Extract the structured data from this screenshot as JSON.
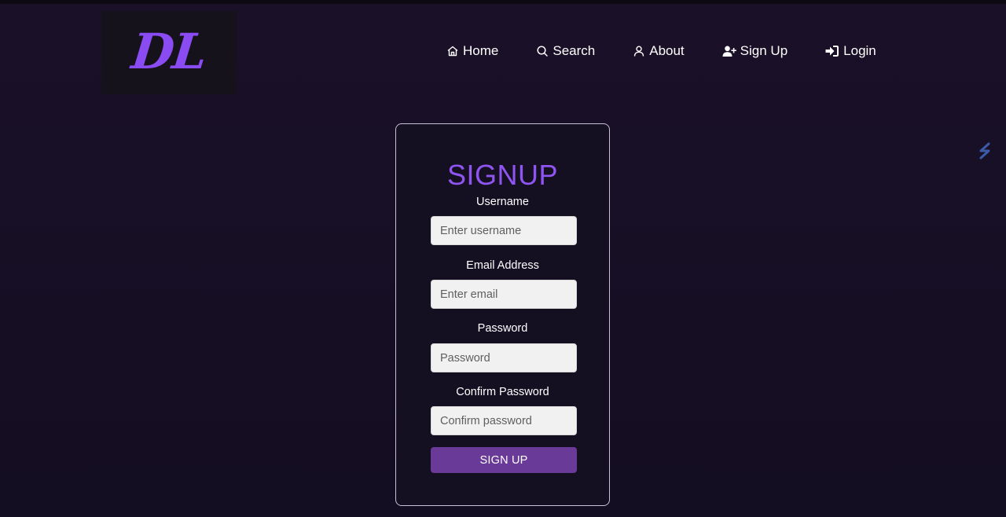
{
  "logo": {
    "text": "DL",
    "color": "#8a4cf2"
  },
  "nav": {
    "items": [
      {
        "label": "Home",
        "icon": "home-icon"
      },
      {
        "label": "Search",
        "icon": "search-icon"
      },
      {
        "label": "About",
        "icon": "user-icon"
      },
      {
        "label": "Sign Up",
        "icon": "user-plus-icon"
      },
      {
        "label": "Login",
        "icon": "login-icon"
      }
    ]
  },
  "signup": {
    "title": "SIGNUP",
    "title_color": "#8f55f0",
    "fields": {
      "username": {
        "label": "Username",
        "placeholder": "Enter username",
        "value": ""
      },
      "email": {
        "label": "Email Address",
        "placeholder": "Enter email",
        "value": ""
      },
      "password": {
        "label": "Password",
        "placeholder": "Password",
        "value": ""
      },
      "confirm_password": {
        "label": "Confirm Password",
        "placeholder": "Confirm password",
        "value": ""
      }
    },
    "submit_label": "SIGN UP",
    "submit_color": "#6a3a98"
  },
  "extension": {
    "icon": "extension-icon"
  },
  "colors": {
    "background": "#150f24",
    "accent": "#8f55f0"
  }
}
